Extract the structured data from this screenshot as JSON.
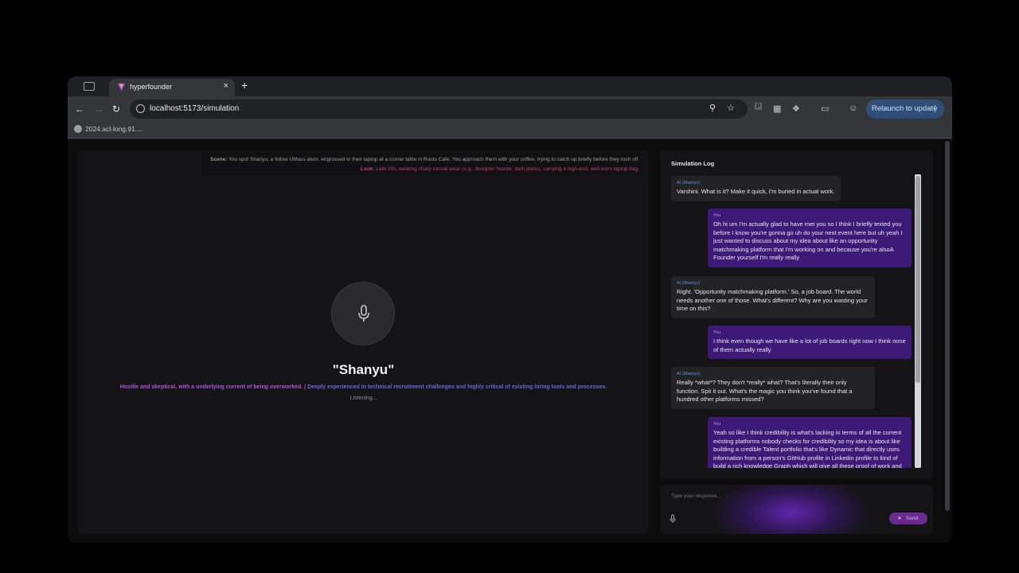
{
  "browser": {
    "tab_title": "hyperfounder",
    "tab_close": "×",
    "new_tab": "+",
    "url": "localhost:5173/simulation",
    "relaunch_label": "Relaunch to update",
    "bookmark": "2024.acl-long.91...."
  },
  "scene": {
    "scene_label": "Scene:",
    "scene_text": "You spot Shanyu, a fellow UMass alum, engrossed in their laptop at a corner table in Roots Cafe. You approach them with your coffee, trying to catch up briefly before they rush off.",
    "look_label": "Look:",
    "look_text": "Late 20s, wearing sharp casual wear (e.g., designer hoodie, dark jeans), carrying a high-end, well-worn laptop bag."
  },
  "character": {
    "name": "\"Shanyu\"",
    "trait1": "Hostile and skeptical, with a underlying current of being overworked.",
    "separator": "|",
    "trait2": "Deeply experienced in technical recruitment challenges and highly critical of existing hiring tools and processes.",
    "status": "Listening..."
  },
  "log": {
    "title": "Simulation Log",
    "messages": [
      {
        "who": "AI (Shanyu)",
        "text": "Varshini. What is it? Make it quick, I'm buried in actual work."
      },
      {
        "who": "You",
        "text": "Oh hi um I'm actually glad to have met you so I think I briefly texted you before I know you're gonna go uh do your next event here but uh yeah I just wanted to discuss about my idea about like an opportunity matchmaking platform that I'm working on and because you're alsoA Founder yourself I'm really really"
      },
      {
        "who": "AI (Shanyu)",
        "text": "Right. 'Opportunity matchmaking platform.' So, a job board. The world needs another one of those. What's different? Why are you wasting your time on this?"
      },
      {
        "who": "You",
        "text": "I think even though we have like a lot of job boards right now I think none of them actually really"
      },
      {
        "who": "AI (Shanyu)",
        "text": "Really *what*? They don't *really* what? That's literally their only function. Spit it out. What's the magic you think you've found that a hundred other platforms missed?"
      },
      {
        "who": "You",
        "text": "Yeah so like I think credibility is what's lacking in terms of all the current existing platforms nobody checks for credibility so my idea is about like building a credible Talent portfolio that's like Dynamic that directly uses information from a person's GitHub profile in Linkedin profile to kind of build a rich knowledge Graph which will give all these proof of work and"
      }
    ]
  },
  "input": {
    "placeholder": "Type your response...",
    "send_label": "Send"
  }
}
